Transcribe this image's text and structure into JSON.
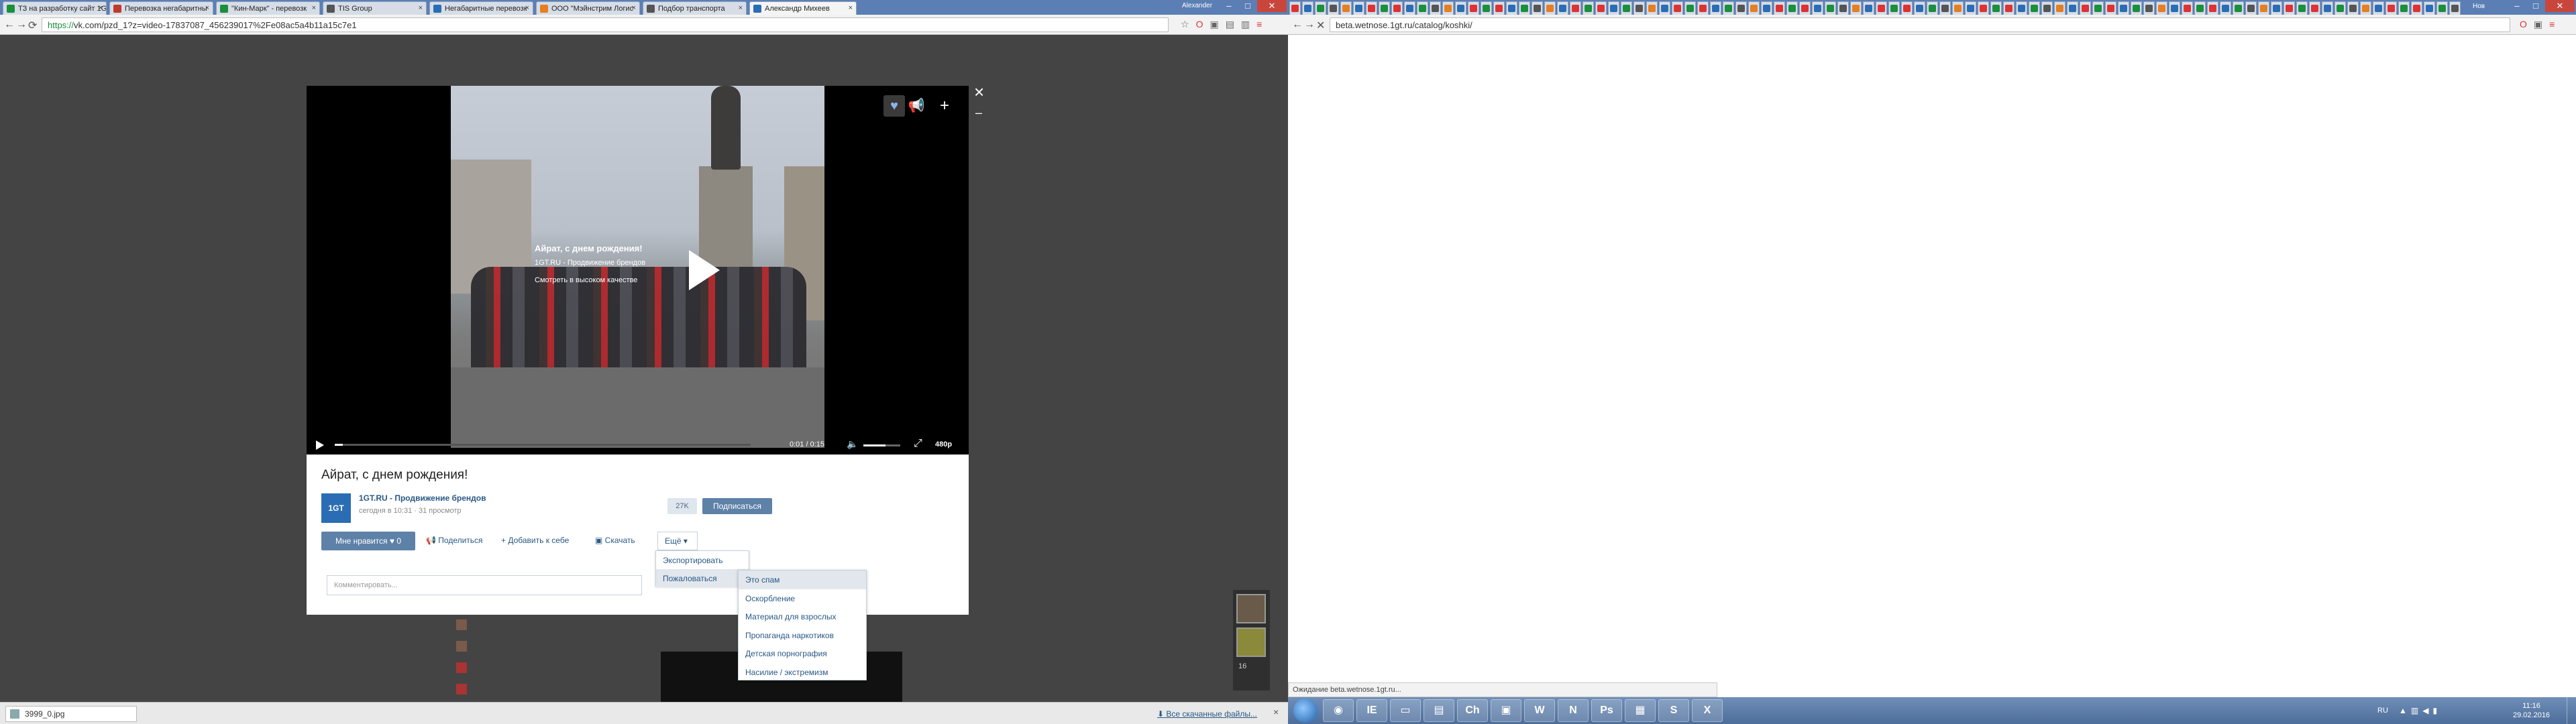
{
  "left_browser": {
    "tabs": [
      {
        "label": "ТЗ на разработку сайт 1G",
        "color": "#1a8f3c"
      },
      {
        "label": "Перевозка негабаритны",
        "color": "#c0392b"
      },
      {
        "label": "\"Кин-Марк\" - перевозк",
        "color": "#1a8f3c"
      },
      {
        "label": "TIS Group",
        "color": "#555555"
      },
      {
        "label": "Негабаритные перевозк",
        "color": "#2a6db5"
      },
      {
        "label": "ООО \"Мэйнстрим Логис",
        "color": "#e67e22"
      },
      {
        "label": "Подбор транспорта",
        "color": "#555555"
      },
      {
        "label": "Александр Михеев",
        "color": "#2a6db5"
      }
    ],
    "user_name": "Alexander",
    "url_scheme": "https://",
    "url_rest": "vk.com/pzd_1?z=video-17837087_456239017%2Fe08ac5a4b11a15c7e1"
  },
  "video": {
    "overlay_title": "Айрат, с днем рождения!",
    "overlay_channel": "1GT.RU - Продвижение брендов",
    "overlay_hd": "Смотреть в высоком качестве",
    "progress": 0.02,
    "time": "0:01 / 0:15",
    "volume": 0.6,
    "quality": "480p",
    "title": "Айрат, с днем рождения!",
    "channel_logo": "1GT",
    "channel_name": "1GT.RU - Продвижение брендов",
    "meta": "сегодня в 10:31 · 31 просмотр",
    "sub_count": "27K",
    "subscribe": "Подписаться",
    "like": "Мне нравится ♥ 0",
    "share": "Поделиться",
    "add": "Добавить к себе",
    "download": "Скачать",
    "more": "Ещё",
    "comment_placeholder": "Комментировать..."
  },
  "more_menu": {
    "export": "Экспортировать",
    "report": "Пожаловаться"
  },
  "report_menu": [
    "Это спам",
    "Оскорбление",
    "Материал для взрослых",
    "Пропаганда наркотиков",
    "Детская порнография",
    "Насилие / экстремизм"
  ],
  "thumbs_count": "16",
  "download_bar": {
    "file": "3999_0.jpg",
    "all_downloads": "Все скачанные файлы..."
  },
  "right_browser": {
    "url": "beta.wetnose.1gt.ru/catalog/koshki/",
    "status": "Ожидание beta.wetnose.1gt.ru...",
    "user_name": "Нов"
  },
  "taskbar": {
    "apps": [
      "IE",
      "Ch",
      "W",
      "N",
      "Ps",
      "S",
      "X"
    ],
    "lang": "RU",
    "time": "11:16",
    "date": "29.02.2016"
  }
}
